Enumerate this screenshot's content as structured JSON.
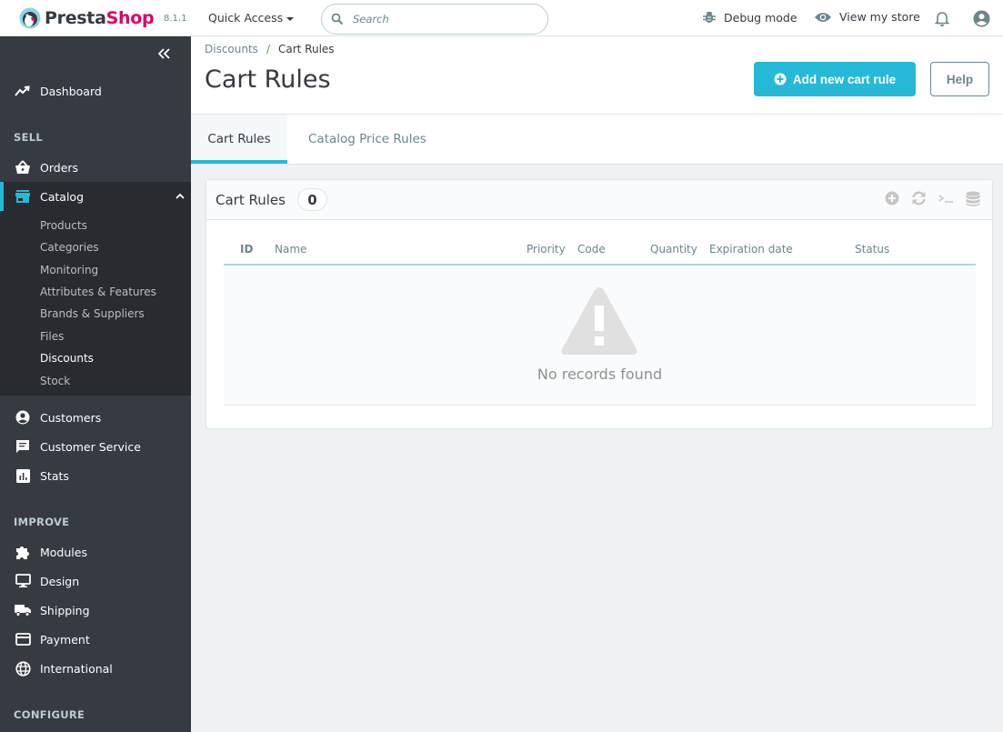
{
  "header": {
    "brand_part1": "Presta",
    "brand_part2": "Shop",
    "version": "8.1.1",
    "quick_access": "Quick Access",
    "search_placeholder": "Search",
    "debug_mode": "Debug mode",
    "view_store": "View my store"
  },
  "sidebar": {
    "dashboard": "Dashboard",
    "sections": {
      "sell": "SELL",
      "improve": "IMPROVE",
      "configure": "CONFIGURE"
    },
    "sell_items": [
      {
        "label": "Orders",
        "icon": "basket-icon"
      },
      {
        "label": "Catalog",
        "icon": "store-icon",
        "active": true
      }
    ],
    "catalog_sub": [
      "Products",
      "Categories",
      "Monitoring",
      "Attributes & Features",
      "Brands & Suppliers",
      "Files",
      "Discounts",
      "Stock"
    ],
    "catalog_active_sub": "Discounts",
    "sell_items_after": [
      {
        "label": "Customers",
        "icon": "account-circle-icon"
      },
      {
        "label": "Customer Service",
        "icon": "chat-icon"
      },
      {
        "label": "Stats",
        "icon": "bar-chart-icon"
      }
    ],
    "improve_items": [
      {
        "label": "Modules",
        "icon": "puzzle-icon"
      },
      {
        "label": "Design",
        "icon": "desktop-icon"
      },
      {
        "label": "Shipping",
        "icon": "truck-icon"
      },
      {
        "label": "Payment",
        "icon": "credit-card-icon"
      },
      {
        "label": "International",
        "icon": "globe-icon"
      }
    ]
  },
  "page": {
    "breadcrumb": {
      "parent": "Discounts",
      "separator": "/",
      "current": "Cart Rules"
    },
    "title": "Cart Rules",
    "add_button": "Add new cart rule",
    "help_button": "Help",
    "tabs": [
      {
        "label": "Cart Rules",
        "active": true
      },
      {
        "label": "Catalog Price Rules",
        "active": false
      }
    ]
  },
  "panel": {
    "title": "Cart Rules",
    "count": "0",
    "columns": [
      "ID",
      "Name",
      "Priority",
      "Code",
      "Quantity",
      "Expiration date",
      "Status"
    ],
    "empty_message": "No records found"
  },
  "colors": {
    "accent": "#25b9d7",
    "sidebar_bg": "#363a41",
    "brand_pink": "#df0067"
  }
}
